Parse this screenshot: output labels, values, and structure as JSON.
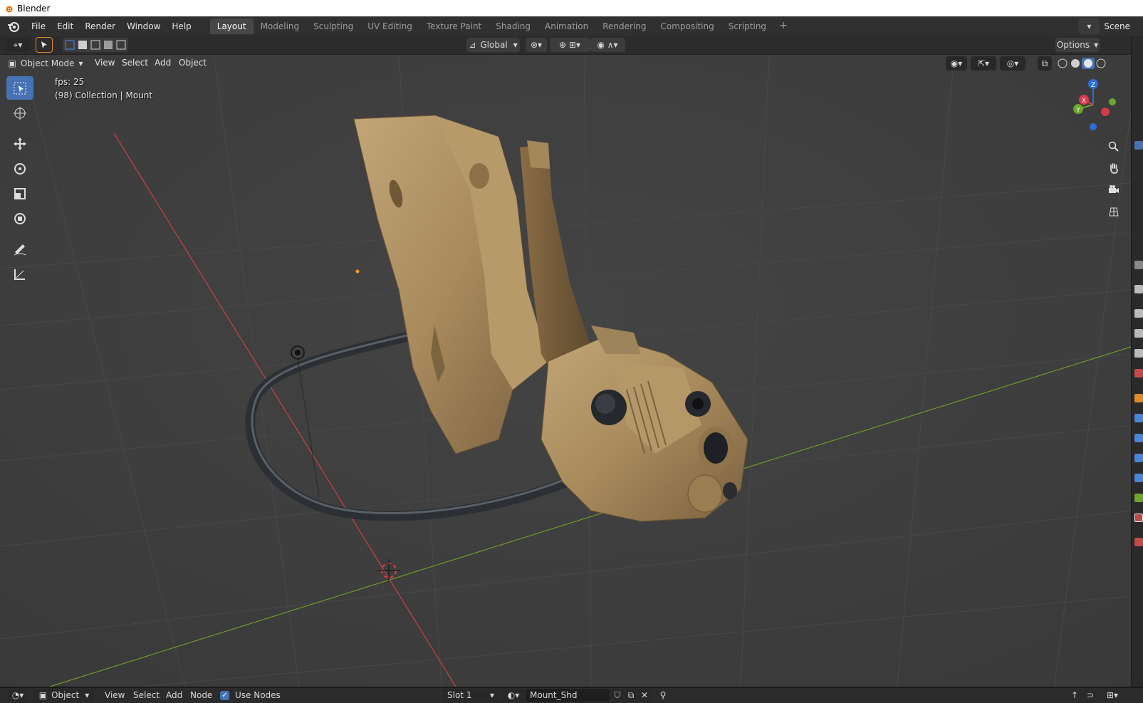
{
  "window": {
    "title": "Blender"
  },
  "menu": {
    "items": [
      "File",
      "Edit",
      "Render",
      "Window",
      "Help"
    ]
  },
  "workspaces": {
    "tabs": [
      "Layout",
      "Modeling",
      "Sculpting",
      "UV Editing",
      "Texture Paint",
      "Shading",
      "Animation",
      "Rendering",
      "Compositing",
      "Scripting"
    ],
    "active": "Layout",
    "add": "+"
  },
  "scene": {
    "label": "Scene"
  },
  "tool_settings": {
    "orientation": "Global",
    "options": "Options"
  },
  "viewport_header": {
    "mode": "Object Mode",
    "menus": [
      "View",
      "Select",
      "Add",
      "Object"
    ]
  },
  "overlay": {
    "fps": "fps: 25",
    "collection": "(98) Collection | Mount"
  },
  "gizmo": {
    "z": "Z",
    "x": "X",
    "y": "Y"
  },
  "shader_header": {
    "editor_type": "Object",
    "menus": [
      "View",
      "Select",
      "Add",
      "Node"
    ],
    "use_nodes_label": "Use Nodes",
    "use_nodes_checked": true,
    "slot": "Slot 1",
    "material": "Mount_Shd"
  },
  "colors": {
    "accent": "#4772b3",
    "viewport_bg": "#3d3d3d",
    "x_axis": "#c9404a",
    "y_axis": "#6e9a2c",
    "model_tan": "#a88a5c",
    "cable": "#2c3035"
  }
}
